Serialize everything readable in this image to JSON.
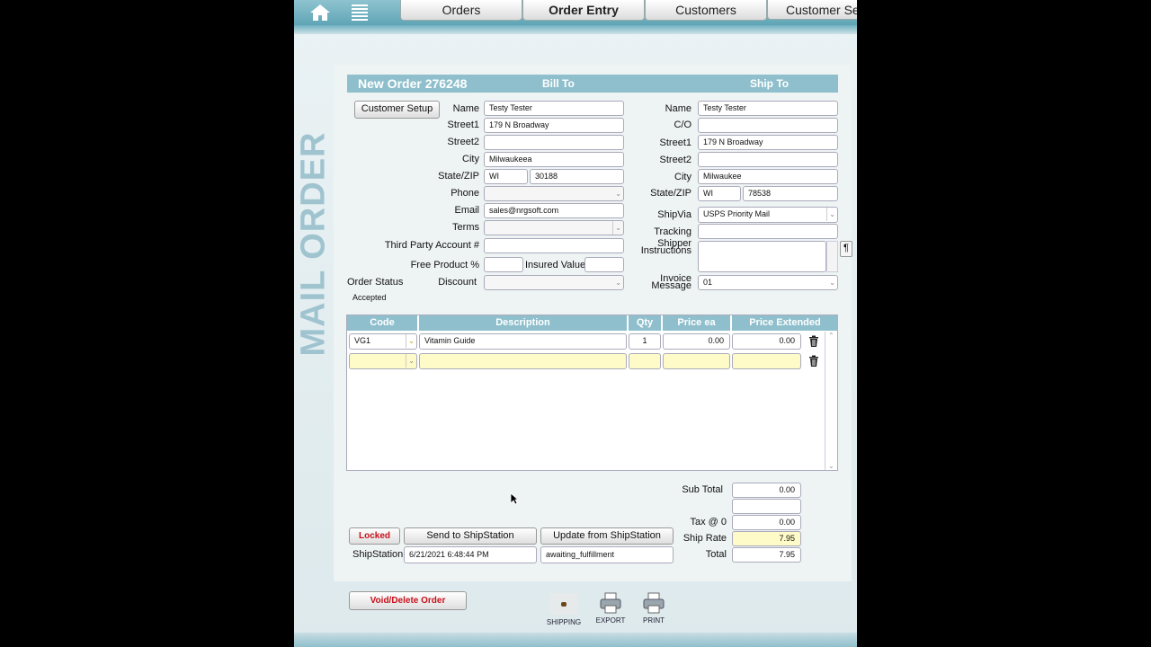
{
  "nav": {
    "tabs": [
      "Orders",
      "Order Entry",
      "Customers",
      "Customer Set"
    ],
    "active_tab": "Order Entry"
  },
  "sidebar_title": "MAIL ORDER",
  "order": {
    "title": "New Order 276248",
    "bill_to_header": "Bill To",
    "ship_to_header": "Ship To",
    "customer_setup_label": "Customer Setup",
    "order_status_label": "Order Status",
    "order_status_value": "Accepted"
  },
  "bill_to": {
    "labels": {
      "name": "Name",
      "street1": "Street1",
      "street2": "Street2",
      "city": "City",
      "state_zip": "State/ZIP",
      "phone": "Phone",
      "email": "Email",
      "terms": "Terms",
      "third_party": "Third Party Account #",
      "free_product": "Free Product %",
      "insured_value": "Insured Value",
      "discount": "Discount"
    },
    "values": {
      "name": "Testy Tester",
      "street1": "179 N Broadway",
      "street2": "",
      "city": "Milwaukeea",
      "state": "WI",
      "zip": "30188",
      "phone": "",
      "email": "sales@nrgsoft.com",
      "terms": "",
      "third_party": "",
      "free_product": "",
      "insured_value": "",
      "discount": ""
    }
  },
  "ship_to": {
    "labels": {
      "name": "Name",
      "co": "C/O",
      "street1": "Street1",
      "street2": "Street2",
      "city": "City",
      "state_zip": "State/ZIP",
      "ship_via": "ShipVia",
      "tracking": "Tracking",
      "shipper_instructions_1": "Shipper",
      "shipper_instructions_2": "Instructions",
      "invoice_message_1": "Invoice",
      "invoice_message_2": "Message"
    },
    "values": {
      "name": "Testy Tester",
      "co": "",
      "street1": "179 N Broadway",
      "street2": "",
      "city": "Milwaukee",
      "state": "WI",
      "zip": "78538",
      "ship_via": "USPS Priority Mail",
      "tracking": "",
      "shipper_instructions": "",
      "invoice_message": "01"
    }
  },
  "line_items": {
    "headers": [
      "Code",
      "Description",
      "Qty",
      "Price ea",
      "Price Extended"
    ],
    "rows": [
      {
        "code": "VG1",
        "description": "Vitamin Guide",
        "qty": "1",
        "price_ea": "0.00",
        "price_extended": "0.00"
      },
      {
        "code": "",
        "description": "",
        "qty": "",
        "price_ea": "",
        "price_extended": ""
      }
    ]
  },
  "totals": {
    "subtotal_label": "Sub Total",
    "subtotal": "0.00",
    "blank": "",
    "tax_label": "Tax @ 0",
    "tax": "0.00",
    "ship_rate_label": "Ship Rate",
    "ship_rate": "7.95",
    "total_label": "Total",
    "total": "7.95"
  },
  "shipstation": {
    "locked_label": "Locked",
    "send_label": "Send to ShipStation",
    "update_label": "Update from ShipStation",
    "label": "ShipStation",
    "timestamp": "6/21/2021 6:48:44 PM",
    "status": "awaiting_fulfillment"
  },
  "footer": {
    "void_label": "Void/Delete Order",
    "shipping_label": "SHIPPING",
    "export_label": "EXPORT",
    "print_label": "PRINT"
  },
  "colors": {
    "accent": "#8fbfcc",
    "highlight_yellow": "#fffbc8",
    "danger": "#c8101a"
  },
  "icons": [
    "home-icon",
    "list-icon",
    "trash-icon",
    "paragraph-icon",
    "shipping-icon",
    "printer-icon"
  ]
}
